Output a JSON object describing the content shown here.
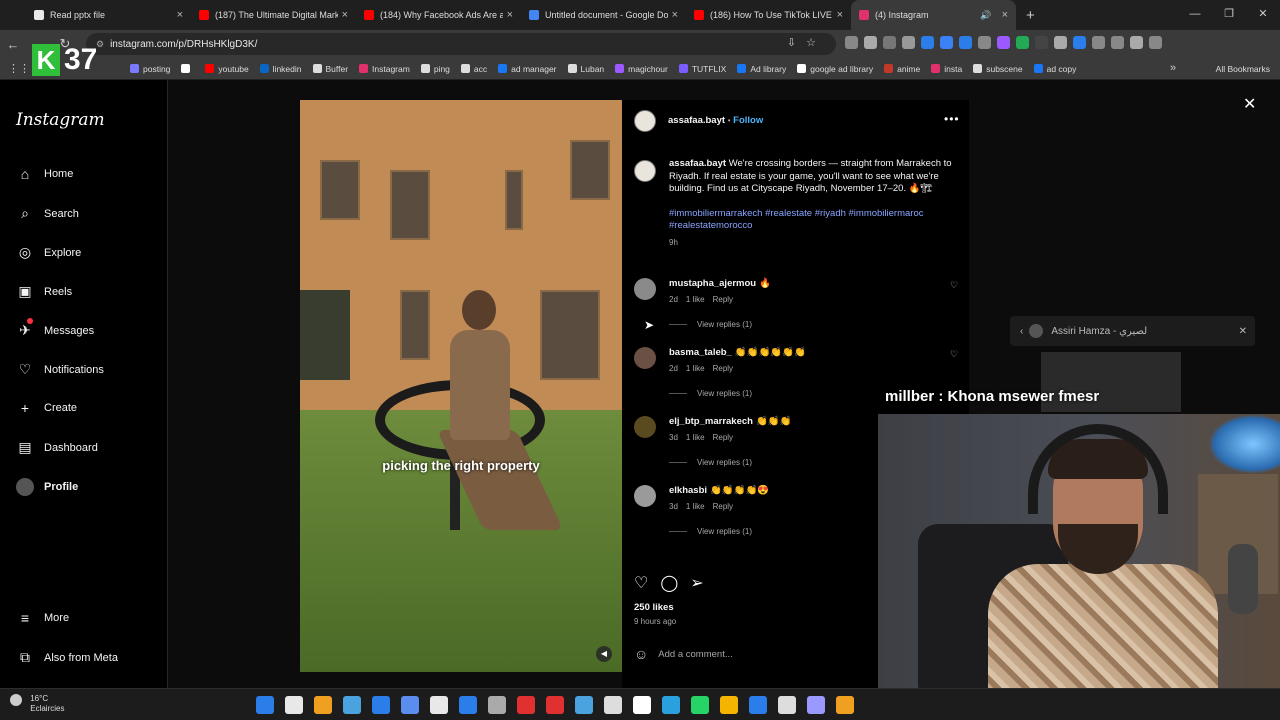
{
  "browser": {
    "tabs": [
      {
        "title": "Read pptx file",
        "color": "#e9e9e9",
        "active": false
      },
      {
        "title": "(187) The Ultimate Digital Marke",
        "color": "#ff0000",
        "active": false
      },
      {
        "title": "(184) Why Facebook Ads Are a",
        "color": "#ff0000",
        "active": false
      },
      {
        "title": "Untitled document - Google Do",
        "color": "#4285f4",
        "active": false
      },
      {
        "title": "(186) How To Use TikTok LIVE S",
        "color": "#ff0000",
        "active": false
      },
      {
        "title": "(4) Instagram",
        "color": "#e1306c",
        "active": true
      }
    ],
    "url": "instagram.com/p/DRHsHKlgD3K/",
    "bookmarks": [
      {
        "label": "posting",
        "color": "#7a7aff"
      },
      {
        "label": "",
        "color": "#ffffff"
      },
      {
        "label": "youtube",
        "color": "#ff0000"
      },
      {
        "label": "linkedin",
        "color": "#0a66c2"
      },
      {
        "label": "Buffer",
        "color": "#dddddd"
      },
      {
        "label": "Instagram",
        "color": "#e1306c"
      },
      {
        "label": "ping",
        "color": "#dddddd"
      },
      {
        "label": "acc",
        "color": "#dddddd"
      },
      {
        "label": "ad manager",
        "color": "#1877f2"
      },
      {
        "label": "Luban",
        "color": "#dddddd"
      },
      {
        "label": "magichour",
        "color": "#9b59ff"
      },
      {
        "label": "TUTFLIX",
        "color": "#7a5cff"
      },
      {
        "label": "Ad library",
        "color": "#1877f2"
      },
      {
        "label": "google ad library",
        "color": "#ffffff"
      },
      {
        "label": "anime",
        "color": "#c0392b"
      },
      {
        "label": "insta",
        "color": "#e1306c"
      },
      {
        "label": "subscene",
        "color": "#dddddd"
      },
      {
        "label": "ad copy",
        "color": "#1877f2"
      }
    ],
    "all_bookmarks": "All Bookmarks"
  },
  "overlay": {
    "k": "K",
    "number": "37"
  },
  "sidebar": {
    "logo": "Instagram",
    "items": [
      {
        "label": "Home",
        "icon": "home-icon",
        "glyph": "⌂"
      },
      {
        "label": "Search",
        "icon": "search-icon",
        "glyph": "⌕"
      },
      {
        "label": "Explore",
        "icon": "compass-icon",
        "glyph": "◎"
      },
      {
        "label": "Reels",
        "icon": "reels-icon",
        "glyph": "▣"
      },
      {
        "label": "Messages",
        "icon": "messenger-icon",
        "glyph": "✈"
      },
      {
        "label": "Notifications",
        "icon": "heart-icon",
        "glyph": "♡"
      },
      {
        "label": "Create",
        "icon": "plus-icon",
        "glyph": "+"
      },
      {
        "label": "Dashboard",
        "icon": "dashboard-icon",
        "glyph": "▤"
      },
      {
        "label": "Profile",
        "icon": "avatar-icon",
        "glyph": ""
      }
    ],
    "more": "More",
    "also_from_meta": "Also from Meta"
  },
  "post": {
    "video_caption": "picking the right property",
    "author": "assafaa.bayt",
    "separator": "•",
    "follow": "Follow",
    "caption_text": "We're crossing borders — straight from Marrakech to Riyadh. If real estate is your game, you'll want to see what we're building. Find us at Cityscape Riyadh, November 17–20. 🔥🏗",
    "hashtags": "#immobiliermarrakech #realestate #riyadh #immobiliermaroc #realestatemorocco",
    "caption_age": "9h",
    "comments": [
      {
        "user": "mustapha_ajermou",
        "text": "🔥",
        "age": "2d",
        "likes": "1 like",
        "reply": "Reply",
        "replies": "View replies (1)",
        "liked_icon": true,
        "avatar_color": "#8a8a8a"
      },
      {
        "user": "basma_taleb_",
        "text": "👏👏👏👏👏👏",
        "age": "2d",
        "likes": "1 like",
        "reply": "Reply",
        "replies": "View replies (1)",
        "liked_icon": true,
        "avatar_color": "#6b5045"
      },
      {
        "user": "elj_btp_marrakech",
        "text": "👏👏👏",
        "age": "3d",
        "likes": "1 like",
        "reply": "Reply",
        "replies": "View replies (1)",
        "liked_icon": false,
        "avatar_color": "#5a4a20"
      },
      {
        "user": "elkhasbi",
        "text": "👏👏👏👏😍",
        "age": "3d",
        "likes": "1 like",
        "reply": "Reply",
        "replies": "View replies (1)",
        "liked_icon": false,
        "avatar_color": "#9a9a9a"
      }
    ],
    "likes": "250 likes",
    "posted": "9 hours ago",
    "add_comment_placeholder": "Add a comment..."
  },
  "stream": {
    "popup_name": "Assiri Hamza - لصيري",
    "chat_message": "millber : Khona msewer fmesr"
  },
  "taskbar": {
    "temp": "16°C",
    "condition": "Eclaircies",
    "icons": [
      "#2b7de9",
      "#e8e8e8",
      "#f0a020",
      "#4aa3df",
      "#2b7de9",
      "#5a8dee",
      "#e8e8e8",
      "#2b7de9",
      "#aaaaaa",
      "#e03030",
      "#e03030",
      "#4aa3df",
      "#dddddd",
      "#ffffff",
      "#2aa1de",
      "#25d366",
      "#f4b400",
      "#2b7de9",
      "#dddddd",
      "#9999ff",
      "#f0a020"
    ]
  }
}
